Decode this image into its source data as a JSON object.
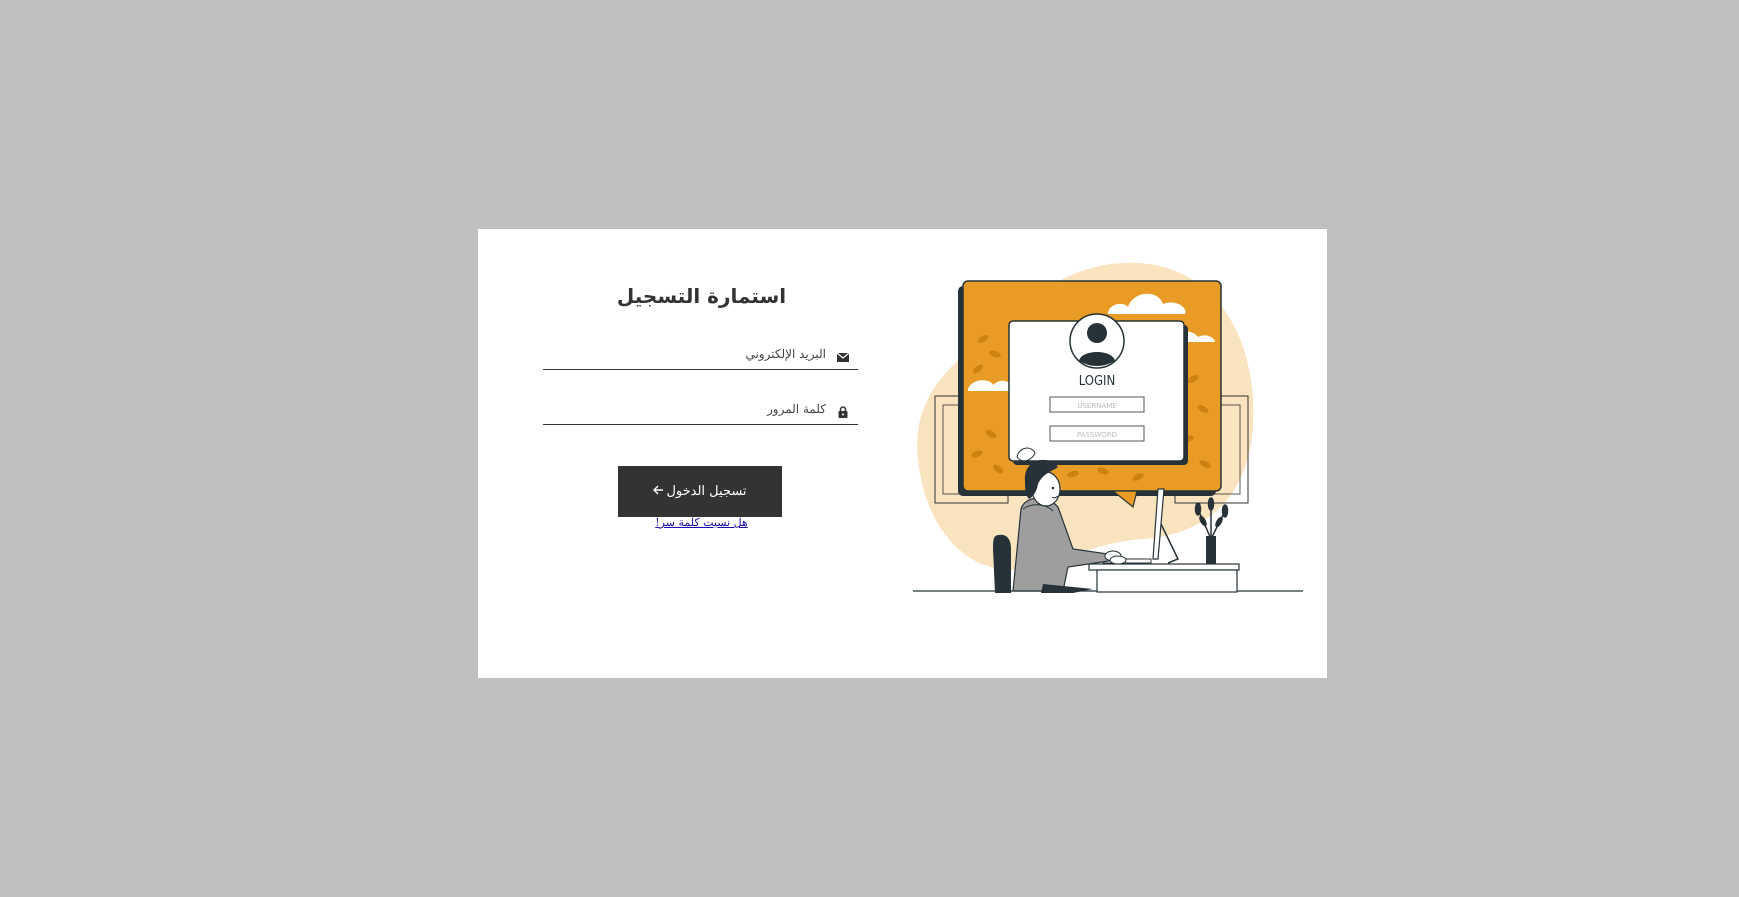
{
  "form": {
    "title": "استمارة التسجيل",
    "email": {
      "placeholder": "البريد الإلكتروني",
      "value": ""
    },
    "password": {
      "placeholder": "كلمة المرور",
      "value": ""
    },
    "login_label": "تسجيل الدخول",
    "forgot_label": "هل نسيت كلمة سر!"
  },
  "illustration": {
    "login_heading": "LOGIN",
    "username_placeholder": "USERNAME",
    "password_placeholder": "PASSWORD"
  },
  "icons": {
    "email": "envelope-icon",
    "password": "lock-icon",
    "login": "arrow-left-icon"
  },
  "colors": {
    "background": "#bfbfbf",
    "card": "#ffffff",
    "button": "#333333",
    "accent_orange": "#e89b25",
    "accent_peach": "#fae3bf",
    "link": "#1a0dab"
  }
}
